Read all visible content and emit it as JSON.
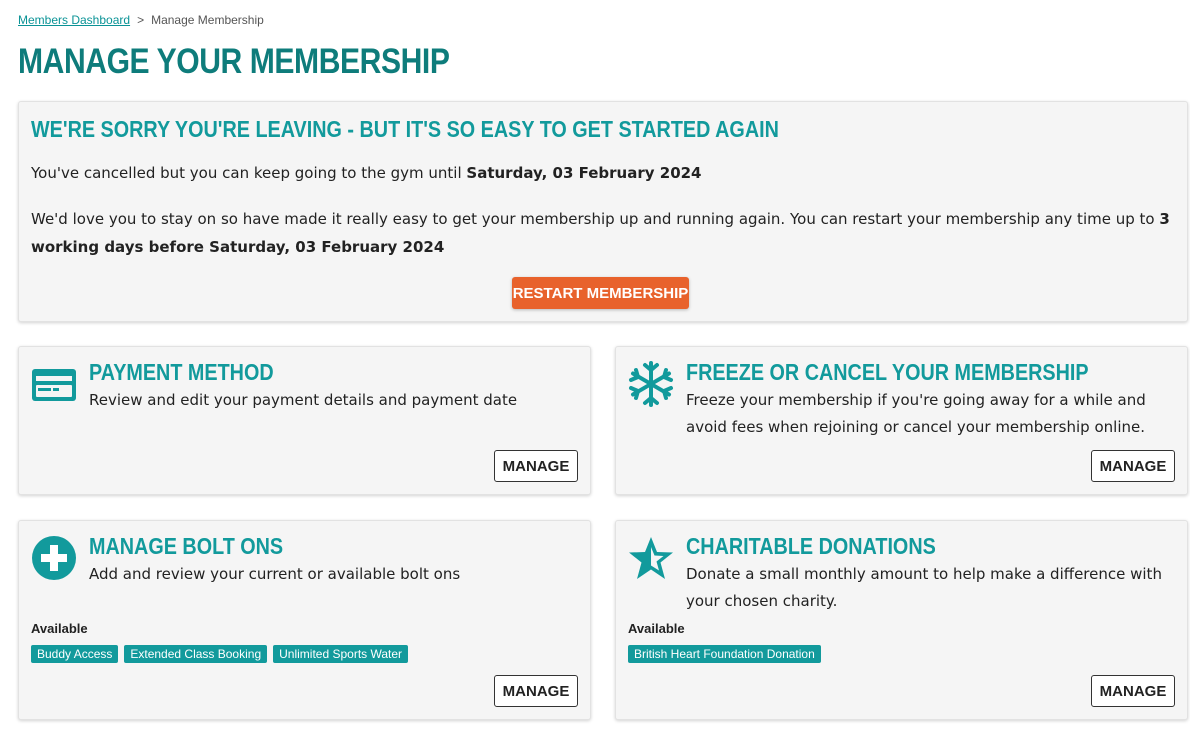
{
  "breadcrumb": {
    "parent": "Members Dashboard",
    "separator": ">",
    "current": "Manage Membership"
  },
  "page": {
    "title": "MANAGE YOUR MEMBERSHIP"
  },
  "banner": {
    "heading": "WE'RE SORRY YOU'RE LEAVING - BUT IT'S SO EASY TO GET STARTED AGAIN",
    "line1_prefix": "You've cancelled but you can keep going to the gym until ",
    "line1_date": "Saturday, 03 February 2024",
    "line2_prefix": "We'd love you to stay on so have made it really easy to get your membership up and running again. You can restart your membership any time up to ",
    "line2_bold": "3 working days before Saturday, 03 February 2024",
    "restart_label": "RESTART MEMBERSHIP"
  },
  "tiles": {
    "payment": {
      "title": "PAYMENT METHOD",
      "description": "Review and edit your payment details and payment date",
      "button": "MANAGE",
      "icon": "credit-card-icon"
    },
    "freeze": {
      "title": "FREEZE OR CANCEL YOUR MEMBERSHIP",
      "description": "Freeze your membership if you're going away for a while and avoid fees when rejoining or cancel your membership online.",
      "button": "MANAGE",
      "icon": "snowflake-icon"
    },
    "boltons": {
      "title": "MANAGE BOLT ONS",
      "description": "Add and review your current or available bolt ons",
      "available_label": "Available",
      "chips": [
        "Buddy Access",
        "Extended Class Booking",
        "Unlimited Sports Water"
      ],
      "button": "MANAGE",
      "icon": "plus-circle-icon"
    },
    "charity": {
      "title": "CHARITABLE DONATIONS",
      "description": "Donate a small monthly amount to help make a difference with your chosen charity.",
      "available_label": "Available",
      "chips": [
        "British Heart Foundation Donation"
      ],
      "button": "MANAGE",
      "icon": "star-icon"
    }
  },
  "colors": {
    "accent": "#129a9c",
    "title": "#0e7c7b",
    "cta": "#e8622c",
    "card_bg": "#f5f5f5"
  }
}
